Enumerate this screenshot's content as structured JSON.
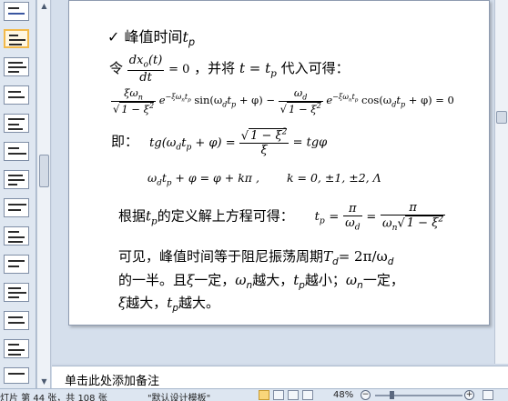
{
  "slide": {
    "heading_check": "✓",
    "heading_text": "峰值时间",
    "heading_var": "t",
    "heading_sub": "p",
    "line1_prefix": "令",
    "line1_num": "dx",
    "line1_num_sub": "o",
    "line1_num_tail": "(t)",
    "line1_den": "dt",
    "line1_eq": "= 0",
    "line1_text": "，并将",
    "line1_expr": "t = t",
    "line1_expr_sub": "p",
    "line1_tail": "代入可得：",
    "eq2_left": "ξω",
    "eq2_left_sub": "n",
    "eq2_sqrt": "1 − ξ",
    "eq2_exp1": "−ξω",
    "eq2_exp1_b": "n",
    "eq2_exp1_c": "t",
    "eq2_exp1_d": "p",
    "eq2_mid": "sin(ω",
    "eq2_mid_sub": "d",
    "eq2_mid_tail": "t",
    "eq2_mid_tail_sub": "p",
    "eq2_mid_end": " + φ) −",
    "eq2_right": "ω",
    "eq2_right_sub": "d",
    "eq2_end": "cos(ω",
    "eq2_end_sub": "d",
    "eq2_end_tail": "t",
    "eq2_end_tail_sub": "p",
    "eq2_end_close": " + φ) = 0",
    "line3_prefix": "即：",
    "line3_left": "tg(ω",
    "line3_left_sub": "d",
    "line3_left_mid": "t",
    "line3_left_mid_sub": "p",
    "line3_left_end": " + φ) =",
    "line3_num": "1 − ξ",
    "line3_den": "ξ",
    "line3_right": "= tgφ",
    "line4_expr_a": "ω",
    "line4_expr_a_sub": "d",
    "line4_expr_b": "t",
    "line4_expr_b_sub": "p",
    "line4_expr_c": " + φ = φ + kπ ,",
    "line4_k": "k = 0, ±1, ±2, Λ",
    "line5_text": "根据",
    "line5_var": "t",
    "line5_var_sub": "p",
    "line5_tail": "的定义解上方程可得：",
    "line5_lhs": "t",
    "line5_lhs_sub": "p",
    "line5_eq": "=",
    "line5_f1_num": "π",
    "line5_f1_den": "ω",
    "line5_f1_den_sub": "d",
    "line5_eq2": "=",
    "line5_f2_num": "π",
    "line5_f2_den": "ω",
    "line5_f2_den_sub": "n",
    "line5_f2_sqrt": "1 − ξ",
    "line6": "可见，峰值时间等于阻尼振荡周期",
    "line6_T": "T",
    "line6_T_sub": "d",
    "line6_eq": "= 2π/ω",
    "line6_eq_sub": "d",
    "line7_a": "的一半。且",
    "line7_xi": "ξ",
    "line7_b": "一定，",
    "line7_w": "ω",
    "line7_w_sub": "n",
    "line7_c": "越大，",
    "line7_t": "t",
    "line7_t_sub": "p",
    "line7_d": "越小；",
    "line7_w2": "ω",
    "line7_w2_sub": "n",
    "line7_e": "一定，",
    "line8_xi": "ξ",
    "line8_a": "越大，",
    "line8_t": "t",
    "line8_t_sub": "p",
    "line8_b": "越大。"
  },
  "notes": {
    "placeholder": "单击此处添加备注"
  },
  "status": {
    "slide_info": "灯片 第 44 张，共 108 张",
    "theme": "\"默认设计模板\"",
    "zoom": "48%",
    "zoom_minus": "−",
    "zoom_plus": "+"
  },
  "thumbnails": {
    "count": 13,
    "selected_index": 1
  }
}
